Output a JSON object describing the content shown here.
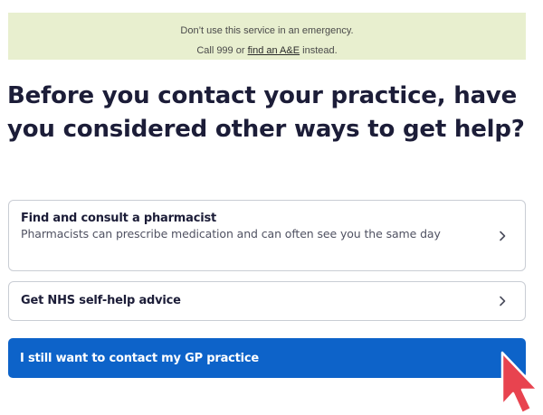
{
  "notice": {
    "line1": "Don’t use this service in an emergency.",
    "line2_prefix": "Call 999 or ",
    "line2_link": "find an A&E",
    "line2_suffix": " instead.",
    "background": "#e8efcf"
  },
  "page_title": "Before you contact your practice, have you considered other ways to get help?",
  "options": [
    {
      "title": "Find and consult a pharmacist",
      "description": "Pharmacists can prescribe medication and can often see you the same day",
      "icon": "chevron-right-icon"
    },
    {
      "title": "Get NHS self-help advice",
      "icon": "chevron-right-icon"
    }
  ],
  "primary_button": {
    "label": "I still want to contact my GP practice",
    "color": "#0d63c9"
  },
  "cursor": {
    "icon": "mouse-pointer-icon",
    "color": "#e8434f"
  }
}
